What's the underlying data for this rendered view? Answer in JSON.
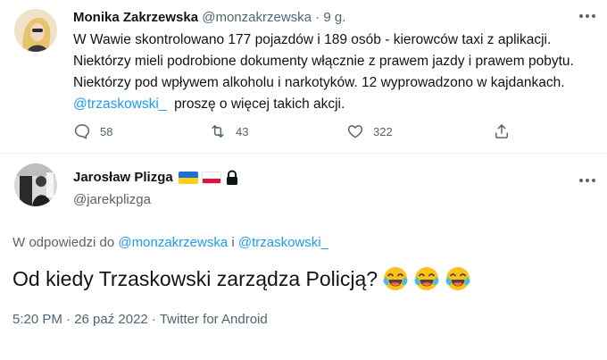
{
  "tweet_parent": {
    "author_name": "Monika Zakrzewska",
    "author_handle": "@monzakrzewska",
    "separator": "·",
    "time_ago": "9 g.",
    "text_before_mention": "W Wawie skontrolowano 177 pojazdów i 189 osób - kierowców taxi z aplikacji. Niektórzy mieli podrobione dokumenty włącznie z prawem jazdy i prawem pobytu. Niektórzy pod wpływem alkoholu i narkotyków. 12 wyprowadzono w kajdankach. ",
    "mention": "@trzaskowski_",
    "text_after_mention": "  proszę o więcej takich akcji.",
    "replies": "58",
    "retweets": "43",
    "likes": "322",
    "avatar_icon": "avatar-photo-icon",
    "more_icon": "more-dots-icon"
  },
  "tweet_main": {
    "author_name": "Jarosław Plizga",
    "author_handle": "@jarekplizga",
    "badges": [
      "flag-ukraine-icon",
      "flag-poland-icon",
      "lock-icon"
    ],
    "replying_prefix": "W odpowiedzi do ",
    "replying_user1": "@monzakrzewska",
    "replying_and": " i ",
    "replying_user2": "@trzaskowski_",
    "text": "Od kiedy Trzaskowski zarządza Policją?",
    "emojis": [
      "joy-emoji",
      "joy-emoji",
      "joy-emoji"
    ],
    "meta": "5:20 PM · 26 paź 2022 · Twitter for Android"
  },
  "colors": {
    "accent": "#1d9bf0",
    "text": "#0f1419",
    "secondary": "#536471",
    "divider": "#eff3f4"
  }
}
